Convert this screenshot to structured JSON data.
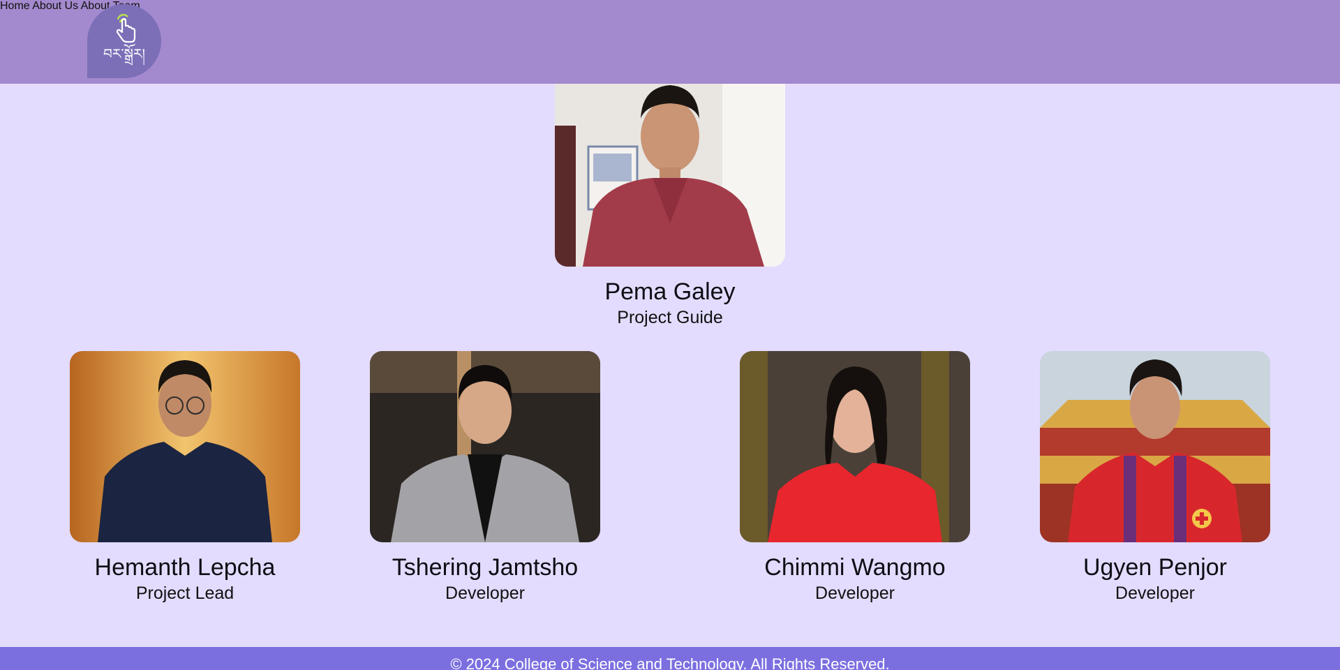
{
  "header": {
    "logo_text": "བར་སྒྲོར།",
    "nav": [
      {
        "label": "Home"
      },
      {
        "label": "About Us"
      },
      {
        "label": "About Team"
      }
    ],
    "background": "#a389cd"
  },
  "team": {
    "guide": {
      "name": "Pema Galey",
      "role": "Project Guide"
    },
    "members": [
      {
        "name": "Hemanth Lepcha",
        "role": "Project Lead"
      },
      {
        "name": "Tshering Jamtsho",
        "role": "Developer"
      },
      {
        "name": "Chimmi Wangmo",
        "role": "Developer"
      },
      {
        "name": "Ugyen Penjor",
        "role": "Developer"
      }
    ]
  },
  "footer": {
    "text": "© 2024 College of Science and Technology. All Rights Reserved."
  },
  "colors": {
    "page_background": "#e3dcfe",
    "footer_background": "#7b6fe0",
    "logo_background": "#7c6fb8"
  }
}
